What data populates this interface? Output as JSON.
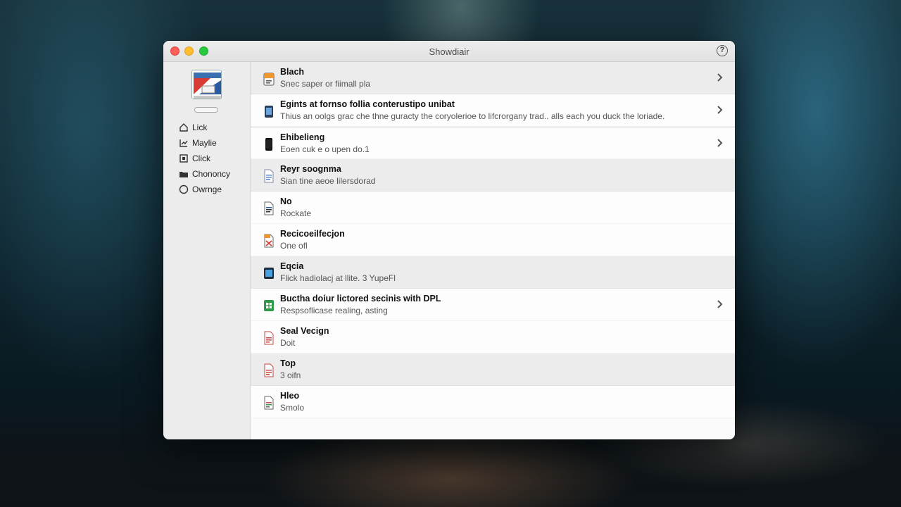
{
  "window": {
    "title": "Showdiair"
  },
  "sidebar": {
    "items": [
      {
        "label": "Lick",
        "icon": "home-icon"
      },
      {
        "label": "Maylie",
        "icon": "chart-icon"
      },
      {
        "label": "Click",
        "icon": "square-icon"
      },
      {
        "label": "Chononcy",
        "icon": "folder-icon"
      },
      {
        "label": "Owrnge",
        "icon": "circle-icon"
      }
    ]
  },
  "list": {
    "rows": [
      {
        "title": "Blach",
        "subtitle": "Snec saper or fiimall pla",
        "icon": "orange-doc-icon",
        "chevron": true
      },
      {
        "title": "Egints at fornso follia conterustipo unibat",
        "subtitle": "Thius an oolgs grac che thne guracty the coryolerioe to lifcrorgany trad.. alls each you duck the loriade.",
        "icon": "blue-device-icon",
        "chevron": true
      },
      {
        "title": "Ehibelieng",
        "subtitle": "Eoen cuk e o upen do.1",
        "icon": "phone-icon",
        "chevron": true
      },
      {
        "title": "Reyr soognma",
        "subtitle": "Sian tine aeoe lilersdorad",
        "icon": "blue-doc-icon",
        "chevron": false
      },
      {
        "title": "No",
        "subtitle": "Rockate",
        "icon": "blue-doc-icon",
        "chevron": false
      },
      {
        "title": "Recicoeilfecjon",
        "subtitle": "One ofl",
        "icon": "red-doc-icon",
        "chevron": false
      },
      {
        "title": "Eqcia",
        "subtitle": "Flick hadiolacj at llite. 3 YupeFl",
        "icon": "blue-app-icon",
        "chevron": false
      },
      {
        "title": "Buctha doiur lictored secinis with DPL",
        "subtitle": "Respsoflicase realing, asting",
        "icon": "green-sheet-icon",
        "chevron": true
      },
      {
        "title": "Seal Vecign",
        "subtitle": "Doit",
        "icon": "red-doc-icon",
        "chevron": false
      },
      {
        "title": "Top",
        "subtitle": "3 oifn",
        "icon": "red-doc-icon",
        "chevron": false
      },
      {
        "title": "Hleo",
        "subtitle": "Smolo",
        "icon": "green-doc-icon",
        "chevron": false
      }
    ]
  },
  "colors": {
    "close": "#fe5f57",
    "minimize": "#febc2e",
    "maximize": "#28c840"
  }
}
